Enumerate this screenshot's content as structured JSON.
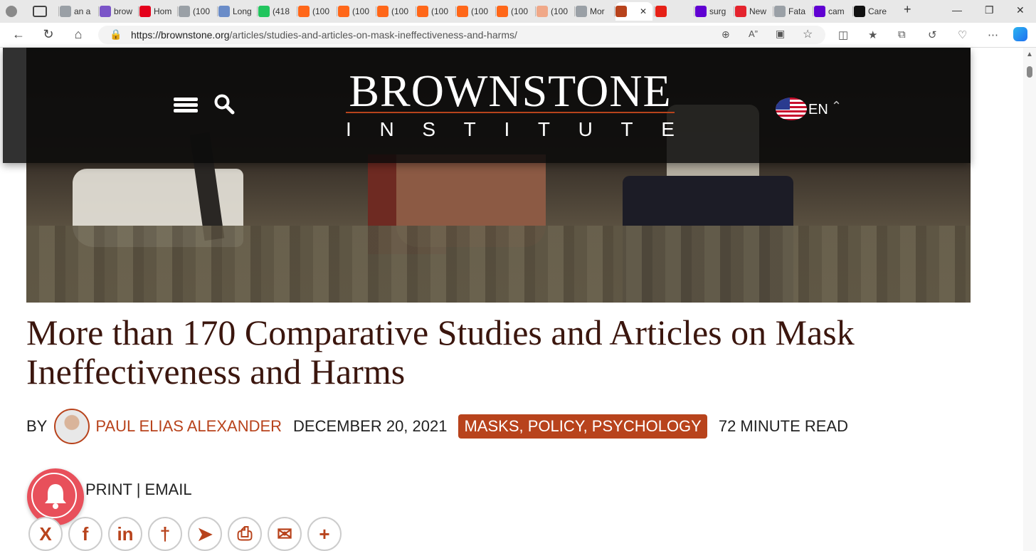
{
  "browser": {
    "tabs": [
      {
        "label": "an a",
        "icon": "page-icon",
        "color": "#9aa0a6"
      },
      {
        "label": "brow",
        "icon": "yahoo-icon",
        "color": "#7b55c8"
      },
      {
        "label": "Hom",
        "icon": "app-icon",
        "color": "#e4001b"
      },
      {
        "label": "(100",
        "icon": "page-icon",
        "color": "#9aa0a6"
      },
      {
        "label": "Long",
        "icon": "five-icon",
        "color": "#6a8cc8"
      },
      {
        "label": "(418",
        "icon": "g-icon",
        "color": "#22c55e"
      },
      {
        "label": "(100",
        "icon": "substack-icon",
        "color": "#ff6719"
      },
      {
        "label": "(100",
        "icon": "substack-icon",
        "color": "#ff6719"
      },
      {
        "label": "(100",
        "icon": "substack-icon",
        "color": "#ff6719"
      },
      {
        "label": "(100",
        "icon": "substack-icon",
        "color": "#ff6719"
      },
      {
        "label": "(100",
        "icon": "substack-icon",
        "color": "#ff6719"
      },
      {
        "label": "(100",
        "icon": "substack-icon",
        "color": "#ff6719"
      },
      {
        "label": "(100",
        "icon": "substack-icon",
        "color": "#f0a888"
      },
      {
        "label": "Mor",
        "icon": "wordpress-icon",
        "color": "#9aa0a6"
      },
      {
        "label": "",
        "icon": "brownstone-icon",
        "color": "#b8431c"
      },
      {
        "label": "",
        "icon": "youtube-icon",
        "color": "#e62117"
      },
      {
        "label": "surg",
        "icon": "yahoo-icon",
        "color": "#6001d2"
      },
      {
        "label": "New",
        "icon": "r-icon",
        "color": "#e4232d"
      },
      {
        "label": "Fata",
        "icon": "arrow-icon",
        "color": "#9aa0a6"
      },
      {
        "label": "cam",
        "icon": "yahoo-icon",
        "color": "#6001d2"
      },
      {
        "label": "Care",
        "icon": "b-icon",
        "color": "#111111"
      }
    ],
    "url_host": "https://brownstone.org",
    "url_path": "/articles/studies-and-articles-on-mask-ineffectiveness-and-harms/"
  },
  "header": {
    "logo_main": "BROWNSTONE",
    "logo_sub": [
      "I",
      "N",
      "S",
      "T",
      "I",
      "T",
      "U",
      "T",
      "E"
    ],
    "language": "EN"
  },
  "article": {
    "title": "More than 170 Comparative Studies and Articles on Mask Ineffectiveness and Harms",
    "by": "BY",
    "author": "PAUL ELIAS ALEXANDER",
    "date": "DECEMBER 20, 2021",
    "categories": "MASKS, POLICY, PSYCHOLOGY",
    "read_time": "72 MINUTE READ",
    "share_text": "PRINT | EMAIL"
  },
  "socials": [
    {
      "name": "x-share-icon",
      "glyph": "X"
    },
    {
      "name": "facebook-share-icon",
      "glyph": "f"
    },
    {
      "name": "linkedin-share-icon",
      "glyph": "in"
    },
    {
      "name": "substack-share-icon",
      "glyph": "†"
    },
    {
      "name": "telegram-share-icon",
      "glyph": "➤"
    },
    {
      "name": "print-share-icon",
      "glyph": "⎙"
    },
    {
      "name": "email-share-icon",
      "glyph": "✉"
    },
    {
      "name": "more-share-icon",
      "glyph": "+"
    }
  ],
  "colors": {
    "accent": "#b8431c",
    "title": "#3b160e",
    "bell": "#e8505b"
  }
}
